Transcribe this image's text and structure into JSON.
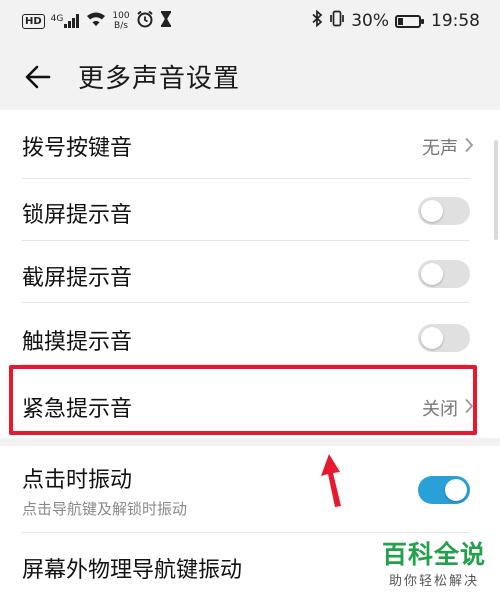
{
  "status_bar": {
    "hd_label": "HD",
    "network_label": "4G",
    "speed_value": "100",
    "speed_unit": "B/s",
    "battery_percent": "30%",
    "battery_level": 0.3,
    "time": "19:58"
  },
  "header": {
    "title": "更多声音设置"
  },
  "settings": {
    "dial_keypad": {
      "label": "拨号按键音",
      "value": "无声"
    },
    "lock_screen": {
      "label": "锁屏提示音",
      "enabled": false
    },
    "screenshot": {
      "label": "截屏提示音",
      "enabled": false
    },
    "touch": {
      "label": "触摸提示音",
      "enabled": false
    },
    "emergency": {
      "label": "紧急提示音",
      "value": "关闭"
    },
    "click_vibration": {
      "label": "点击时振动",
      "description": "点击导航键及解锁时振动",
      "enabled": true
    },
    "nav_key_vibration": {
      "label": "屏幕外物理导航键振动"
    }
  },
  "watermark": {
    "logo": "百科全说",
    "tagline": "助你轻松解决"
  },
  "colors": {
    "accent": "#2aa0d8",
    "highlight": "#e8192c",
    "watermark": "#22a04a"
  }
}
